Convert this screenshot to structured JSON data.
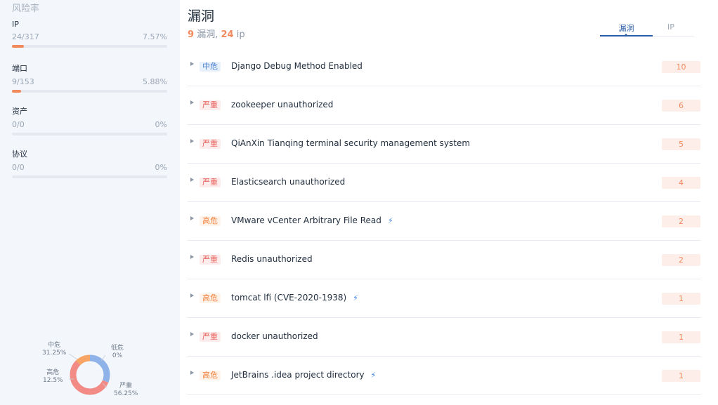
{
  "sidebar": {
    "title": "风险率",
    "metrics": [
      {
        "label": "IP",
        "fraction": "24/317",
        "percent": "7.57%",
        "ratio": 0.0757
      },
      {
        "label": "端口",
        "fraction": "9/153",
        "percent": "5.88%",
        "ratio": 0.0588
      },
      {
        "label": "资产",
        "fraction": "0/0",
        "percent": "0%",
        "ratio": 0
      },
      {
        "label": "协议",
        "fraction": "0/0",
        "percent": "0%",
        "ratio": 0
      }
    ],
    "donut": {
      "segments": [
        {
          "name": "中危",
          "percent_label": "31.25%",
          "value": 31.25,
          "color": "#8fb2e8"
        },
        {
          "name": "低危",
          "percent_label": "0%",
          "value": 0,
          "color": "#7ed3c0"
        },
        {
          "name": "严重",
          "percent_label": "56.25%",
          "value": 56.25,
          "color": "#f28b86"
        },
        {
          "name": "高危",
          "percent_label": "12.5%",
          "value": 12.5,
          "color": "#f7a465"
        }
      ]
    }
  },
  "main": {
    "title": "漏洞",
    "summary": {
      "vuln_count": "9",
      "vuln_label": "漏洞,",
      "ip_count": "24",
      "ip_label": "ip"
    },
    "tabs": [
      {
        "label": "漏洞",
        "active": true
      },
      {
        "label": "IP",
        "active": false
      }
    ],
    "vulns": [
      {
        "severity": "中危",
        "level": "medium",
        "name": "Django Debug Method Enabled",
        "exp": false,
        "count": "10"
      },
      {
        "severity": "严重",
        "level": "critical",
        "name": "zookeeper unauthorized",
        "exp": false,
        "count": "6"
      },
      {
        "severity": "严重",
        "level": "critical",
        "name": "QiAnXin Tianqing terminal security management system",
        "exp": false,
        "count": "5"
      },
      {
        "severity": "严重",
        "level": "critical",
        "name": "Elasticsearch unauthorized",
        "exp": false,
        "count": "4"
      },
      {
        "severity": "高危",
        "level": "high",
        "name": "VMware vCenter Arbitrary File Read",
        "exp": true,
        "count": "2"
      },
      {
        "severity": "严重",
        "level": "critical",
        "name": "Redis unauthorized",
        "exp": false,
        "count": "2"
      },
      {
        "severity": "高危",
        "level": "high",
        "name": "tomcat lfi (CVE-2020-1938)",
        "exp": true,
        "count": "1"
      },
      {
        "severity": "严重",
        "level": "critical",
        "name": "docker unauthorized",
        "exp": false,
        "count": "1"
      },
      {
        "severity": "高危",
        "level": "high",
        "name": "JetBrains .idea project directory",
        "exp": true,
        "count": "1"
      }
    ]
  }
}
